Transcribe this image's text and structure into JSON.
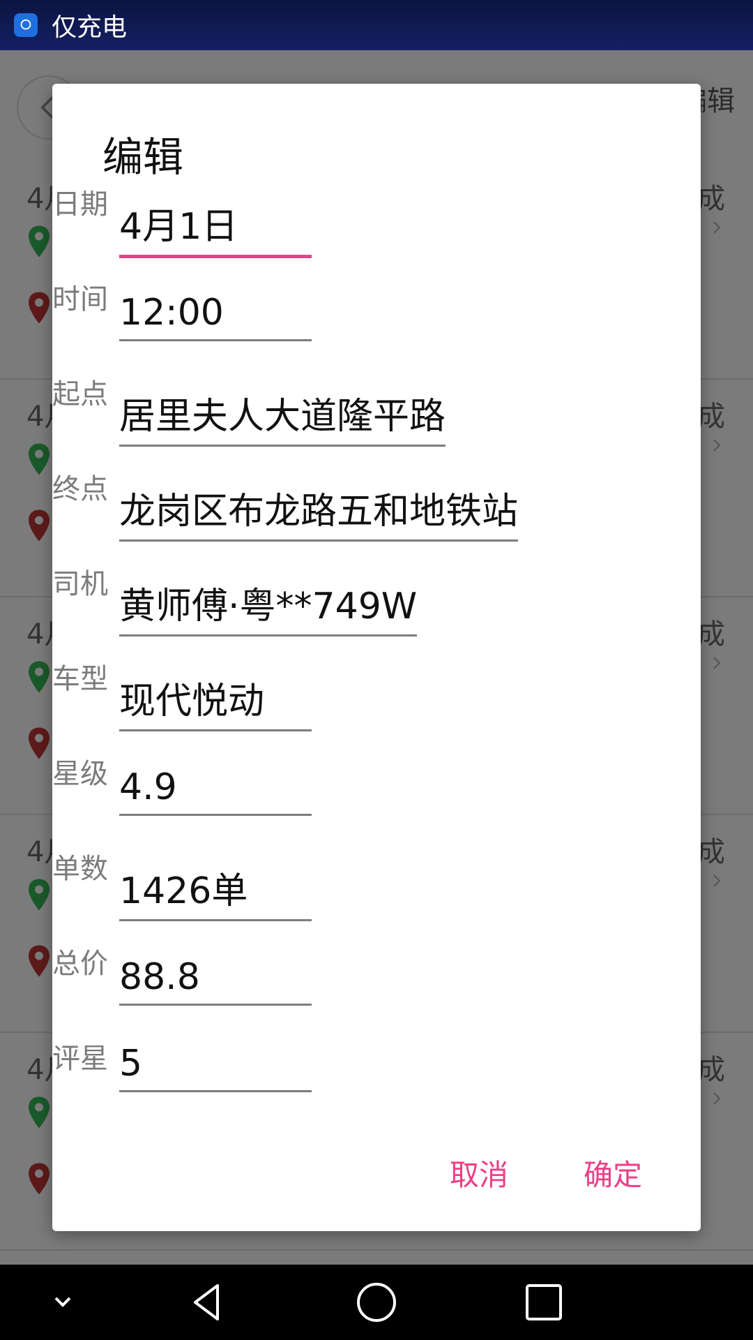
{
  "status_bar": {
    "text": "仅充电"
  },
  "background": {
    "edit_label": "编辑",
    "rows": [
      {
        "date": "4月",
        "status": "成"
      },
      {
        "date": "4月",
        "status": "成"
      },
      {
        "date": "4月",
        "status": "成"
      },
      {
        "date": "4月",
        "status": "成"
      },
      {
        "date": "4月",
        "status": "成"
      }
    ]
  },
  "dialog": {
    "title": "编辑",
    "fields": [
      {
        "label": "日期",
        "value": "4月1日"
      },
      {
        "label": "时间",
        "value": "12:00"
      },
      {
        "label": "起点",
        "value": "居里夫人大道隆平路"
      },
      {
        "label": "终点",
        "value": "龙岗区布龙路五和地铁站"
      },
      {
        "label": "司机",
        "value": "黄师傅·粤**749W"
      },
      {
        "label": "车型",
        "value": "现代悦动"
      },
      {
        "label": "星级",
        "value": "4.9"
      },
      {
        "label": "单数",
        "value": "1426单"
      },
      {
        "label": "总价",
        "value": "88.8"
      },
      {
        "label": "评星",
        "value": "5"
      }
    ],
    "cancel_label": "取消",
    "confirm_label": "确定"
  },
  "colors": {
    "accent": "#ee3f86",
    "status_bar": "#0b1440"
  },
  "icons": {
    "status": "chat-bubble-icon",
    "nav": [
      "chevron-down-icon",
      "back-triangle-icon",
      "home-circle-icon",
      "recents-square-icon"
    ]
  }
}
